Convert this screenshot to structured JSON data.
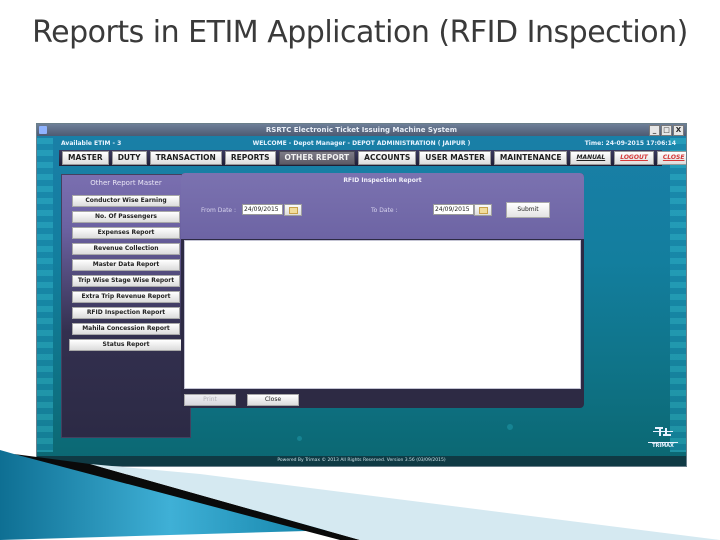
{
  "slide": {
    "title": "Reports in ETIM Application (RFID Inspection)"
  },
  "window": {
    "title": "RSRTC Electronic Ticket Issuing Machine System",
    "controls": {
      "minimize": "_",
      "maximize": "□",
      "close": "X"
    }
  },
  "infobar": {
    "available": "Available ETIM - 3",
    "welcome": "WELCOME - Depot Manager - DEPOT ADMINISTRATION ( JAIPUR )",
    "time": "Time: 24-09-2015  17:06:14"
  },
  "menu": [
    {
      "label": "MASTER",
      "active": false
    },
    {
      "label": "DUTY",
      "active": false
    },
    {
      "label": "TRANSACTION",
      "active": false
    },
    {
      "label": "REPORTS",
      "active": false
    },
    {
      "label": "OTHER REPORT",
      "active": true
    },
    {
      "label": "ACCOUNTS",
      "active": false
    },
    {
      "label": "USER MASTER",
      "active": false
    },
    {
      "label": "MAINTENANCE",
      "active": false
    },
    {
      "label": "MANUAL",
      "active": false
    },
    {
      "label": "LOGOUT",
      "active": false
    },
    {
      "label": "CLOSE",
      "active": false
    }
  ],
  "sidebar": {
    "title": "Other Report Master",
    "items": [
      "Conductor Wise Earning",
      "No. Of Passengers",
      "Expenses Report",
      "Revenue Collection",
      "Master Data Report",
      "Trip Wise Stage Wise Report",
      "Extra Trip Revenue Report",
      "RFID Inspection Report",
      "Mahila Concession Report",
      "Status Report"
    ]
  },
  "panel": {
    "title": "RFID Inspection Report",
    "from_label": "From Date :",
    "from_value": "24/09/2015",
    "to_label": "To Date :",
    "to_value": "24/09/2015",
    "submit": "Submit",
    "print": "Print",
    "close": "Close"
  },
  "footer": {
    "text": "Powered By Trimax © 2013 All Rights Reserved. Version 3.56 (03/09/2015)",
    "logo": "TRIMAX"
  }
}
